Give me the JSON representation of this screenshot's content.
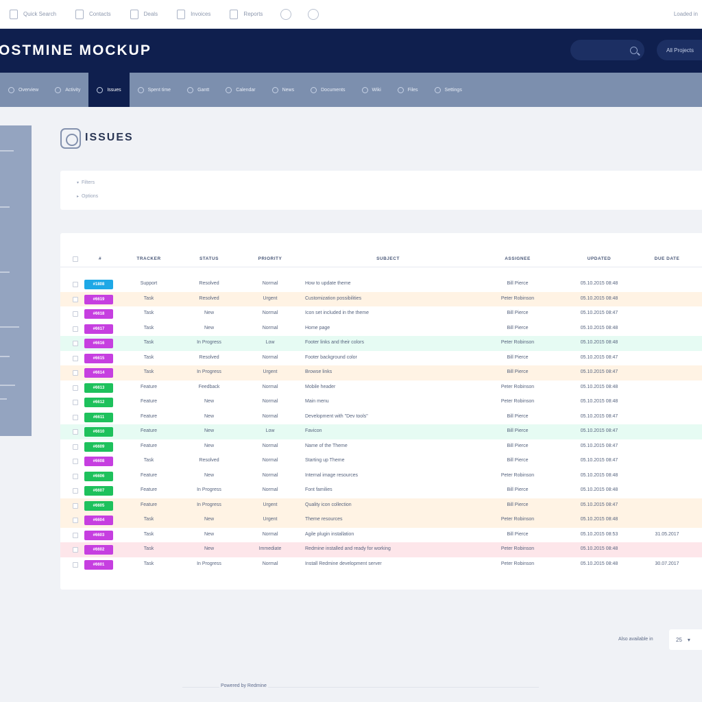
{
  "toolbar": {
    "items": [
      {
        "label": "Quick Search",
        "icon": "search-box-icon"
      },
      {
        "label": "Contacts",
        "icon": "contacts-icon"
      },
      {
        "label": "Deals",
        "icon": "deals-icon"
      },
      {
        "label": "Invoices",
        "icon": "invoices-icon"
      },
      {
        "label": "Reports",
        "icon": "reports-icon"
      }
    ],
    "right_label": "Loaded in"
  },
  "header": {
    "brand": "OSTMINE MOCKUP",
    "project_button": "All Projects"
  },
  "nav": {
    "tabs": [
      {
        "label": "Overview",
        "active": false
      },
      {
        "label": "Activity",
        "active": false
      },
      {
        "label": "Issues",
        "active": true
      },
      {
        "label": "Spent time",
        "active": false
      },
      {
        "label": "Gantt",
        "active": false
      },
      {
        "label": "Calendar",
        "active": false
      },
      {
        "label": "News",
        "active": false
      },
      {
        "label": "Documents",
        "active": false
      },
      {
        "label": "Wiki",
        "active": false
      },
      {
        "label": "Files",
        "active": false
      },
      {
        "label": "Settings",
        "active": false
      }
    ]
  },
  "page": {
    "title": "ISSUES",
    "filters": [
      "Filters",
      "Options"
    ]
  },
  "table": {
    "columns": [
      "#",
      "TRACKER",
      "STATUS",
      "PRIORITY",
      "SUBJECT",
      "ASSIGNEE",
      "UPDATED",
      "DUE DATE"
    ],
    "rows": [
      {
        "id": "#1808",
        "tracker": "Support",
        "status": "Resolved",
        "priority": "Normal",
        "subject": "How to update theme",
        "assignee": "Bill Pierce",
        "updated": "05.10.2015 08:48",
        "due": "",
        "badge_color": "#1ea8e6",
        "row_color": "#ffffff"
      },
      {
        "id": "#6619",
        "tracker": "Task",
        "status": "Resolved",
        "priority": "Urgent",
        "subject": "Customization possibilities",
        "assignee": "Peter Robinson",
        "updated": "05.10.2015 08:48",
        "due": "",
        "badge_color": "#c63fe0",
        "row_color": "#fff3e4"
      },
      {
        "id": "#6618",
        "tracker": "Task",
        "status": "New",
        "priority": "Normal",
        "subject": "Icon set included in the theme",
        "assignee": "Bill Pierce",
        "updated": "05.10.2015 08:47",
        "due": "",
        "badge_color": "#c63fe0",
        "row_color": "#ffffff"
      },
      {
        "id": "#6617",
        "tracker": "Task",
        "status": "New",
        "priority": "Normal",
        "subject": "Home page",
        "assignee": "Bill Pierce",
        "updated": "05.10.2015 08:48",
        "due": "",
        "badge_color": "#c63fe0",
        "row_color": "#ffffff"
      },
      {
        "id": "#6616",
        "tracker": "Task",
        "status": "In Progress",
        "priority": "Low",
        "subject": "Footer links and their colors",
        "assignee": "Peter Robinson",
        "updated": "05.10.2015 08:48",
        "due": "",
        "badge_color": "#c63fe0",
        "row_color": "#e6fbf3"
      },
      {
        "id": "#6615",
        "tracker": "Task",
        "status": "Resolved",
        "priority": "Normal",
        "subject": "Footer background color",
        "assignee": "Bill Pierce",
        "updated": "05.10.2015 08:47",
        "due": "",
        "badge_color": "#c63fe0",
        "row_color": "#ffffff"
      },
      {
        "id": "#6614",
        "tracker": "Task",
        "status": "In Progress",
        "priority": "Urgent",
        "subject": "Browse links",
        "assignee": "Bill Pierce",
        "updated": "05.10.2015 08:47",
        "due": "",
        "badge_color": "#c63fe0",
        "row_color": "#fff3e4"
      },
      {
        "id": "#6613",
        "tracker": "Feature",
        "status": "Feedback",
        "priority": "Normal",
        "subject": "Mobile header",
        "assignee": "Peter Robinson",
        "updated": "05.10.2015 08:48",
        "due": "",
        "badge_color": "#1ec15c",
        "row_color": "#ffffff"
      },
      {
        "id": "#6612",
        "tracker": "Feature",
        "status": "New",
        "priority": "Normal",
        "subject": "Main menu",
        "assignee": "Peter Robinson",
        "updated": "05.10.2015 08:48",
        "due": "",
        "badge_color": "#1ec15c",
        "row_color": "#ffffff"
      },
      {
        "id": "#6611",
        "tracker": "Feature",
        "status": "New",
        "priority": "Normal",
        "subject": "Development with \"Dev tools\"",
        "assignee": "Bill Pierce",
        "updated": "05.10.2015 08:47",
        "due": "",
        "badge_color": "#1ec15c",
        "row_color": "#ffffff"
      },
      {
        "id": "#6610",
        "tracker": "Feature",
        "status": "New",
        "priority": "Low",
        "subject": "Favicon",
        "assignee": "Bill Pierce",
        "updated": "05.10.2015 08:47",
        "due": "",
        "badge_color": "#1ec15c",
        "row_color": "#e6fbf3"
      },
      {
        "id": "#6609",
        "tracker": "Feature",
        "status": "New",
        "priority": "Normal",
        "subject": "Name of the Theme",
        "assignee": "Bill Pierce",
        "updated": "05.10.2015 08:47",
        "due": "",
        "badge_color": "#1ec15c",
        "row_color": "#ffffff"
      },
      {
        "id": "#6608",
        "tracker": "Task",
        "status": "Resolved",
        "priority": "Normal",
        "subject": "Starting up Theme",
        "assignee": "Bill Pierce",
        "updated": "05.10.2015 08:47",
        "due": "",
        "badge_color": "#c63fe0",
        "row_color": "#ffffff"
      },
      {
        "id": "#6606",
        "tracker": "Feature",
        "status": "New",
        "priority": "Normal",
        "subject": "Internal image resources",
        "assignee": "Peter Robinson",
        "updated": "05.10.2015 08:48",
        "due": "",
        "badge_color": "#1ec15c",
        "row_color": "#ffffff"
      },
      {
        "id": "#6607",
        "tracker": "Feature",
        "status": "In Progress",
        "priority": "Normal",
        "subject": "Font families",
        "assignee": "Bill Pierce",
        "updated": "05.10.2015 08:48",
        "due": "",
        "badge_color": "#1ec15c",
        "row_color": "#ffffff"
      },
      {
        "id": "#6605",
        "tracker": "Feature",
        "status": "In Progress",
        "priority": "Urgent",
        "subject": "Quality icon collection",
        "assignee": "Bill Pierce",
        "updated": "05.10.2015 08:47",
        "due": "",
        "badge_color": "#1ec15c",
        "row_color": "#fff3e4"
      },
      {
        "id": "#6604",
        "tracker": "Task",
        "status": "New",
        "priority": "Urgent",
        "subject": "Theme resources",
        "assignee": "Peter Robinson",
        "updated": "05.10.2015 08:48",
        "due": "",
        "badge_color": "#c63fe0",
        "row_color": "#fff3e4"
      },
      {
        "id": "#6603",
        "tracker": "Task",
        "status": "New",
        "priority": "Normal",
        "subject": "Agile plugin installation",
        "assignee": "Bill Pierce",
        "updated": "05.10.2015 08:53",
        "due": "31.05.2017",
        "badge_color": "#c63fe0",
        "row_color": "#ffffff"
      },
      {
        "id": "#6602",
        "tracker": "Task",
        "status": "New",
        "priority": "Immediate",
        "subject": "Redmine installed and ready for working",
        "assignee": "Peter Robinson",
        "updated": "05.10.2015 08:48",
        "due": "",
        "badge_color": "#c63fe0",
        "row_color": "#fde6ea"
      },
      {
        "id": "#6601",
        "tracker": "Task",
        "status": "In Progress",
        "priority": "Normal",
        "subject": "Install Redmine development server",
        "assignee": "Peter Robinson",
        "updated": "05.10.2015 08:48",
        "due": "30.07.2017",
        "badge_color": "#c63fe0",
        "row_color": "#ffffff"
      }
    ]
  },
  "footer": {
    "per_page_label": "Also available in",
    "per_page_value": "25",
    "powered": "Powered by Redmine"
  },
  "colors": {
    "header": "#0f1f4e",
    "nav": "#7c8fae",
    "feature": "#1ec15c",
    "task": "#c63fe0",
    "support": "#1ea8e6"
  }
}
